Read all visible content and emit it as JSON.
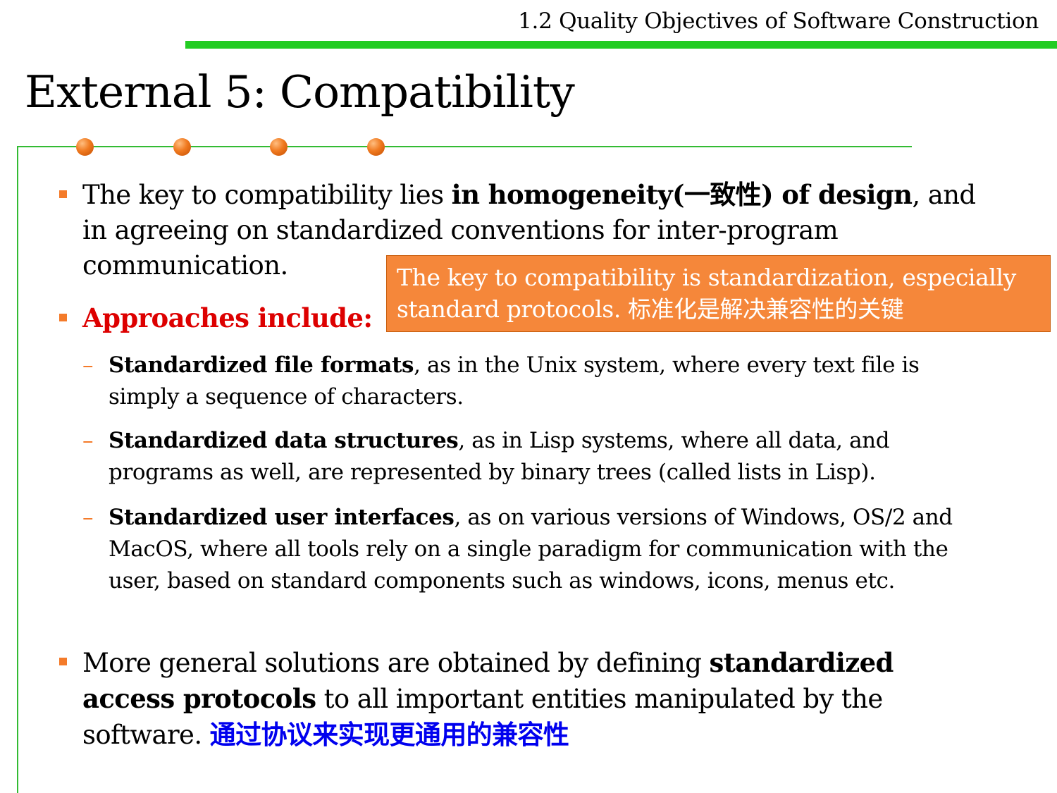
{
  "header": {
    "section_title": "1.2 Quality Objectives of Software Construction",
    "accent_color": "#22cc22"
  },
  "slide": {
    "title": "External 5: Compatibility",
    "frame_color": "#33bb33",
    "dot_color": "#f07a20",
    "bullet_color": "#f47b2a"
  },
  "bullet1": {
    "text_a": "The key to compatibility lies ",
    "bold": "in homogeneity(一致性) of design",
    "text_b": ", and in agreeing on standardized conventions for inter-program communication."
  },
  "callout": {
    "text": "The key to compatibility is standardization, especially standard protocols. 标准化是解决兼容性的关键",
    "background": "#f5873a"
  },
  "bullet2": {
    "label": "Approaches include:",
    "color": "#dd0000"
  },
  "sub_items": [
    {
      "dash": "–",
      "bold": "Standardized file formats",
      "rest": ", as in the Unix system, where every text file is simply a sequence of characters."
    },
    {
      "dash": "–",
      "bold": "Standardized data structures",
      "rest": ", as in Lisp systems, where all data, and programs as well, are represented by binary trees (called lists in Lisp)."
    },
    {
      "dash": "–",
      "bold": "Standardized user interfaces",
      "rest": ", as on various versions of Windows, OS/2 and MacOS, where all tools rely on a single paradigm for communication with the user, based on standard components such as windows, icons, menus etc."
    }
  ],
  "bullet3": {
    "text_a": "More general solutions are obtained by defining ",
    "bold": "standardized access protocols",
    "text_b": " to all important entities manipulated by the software. ",
    "note_cn": "通过协议来实现更通用的兼容性",
    "note_color": "#0000ee"
  }
}
